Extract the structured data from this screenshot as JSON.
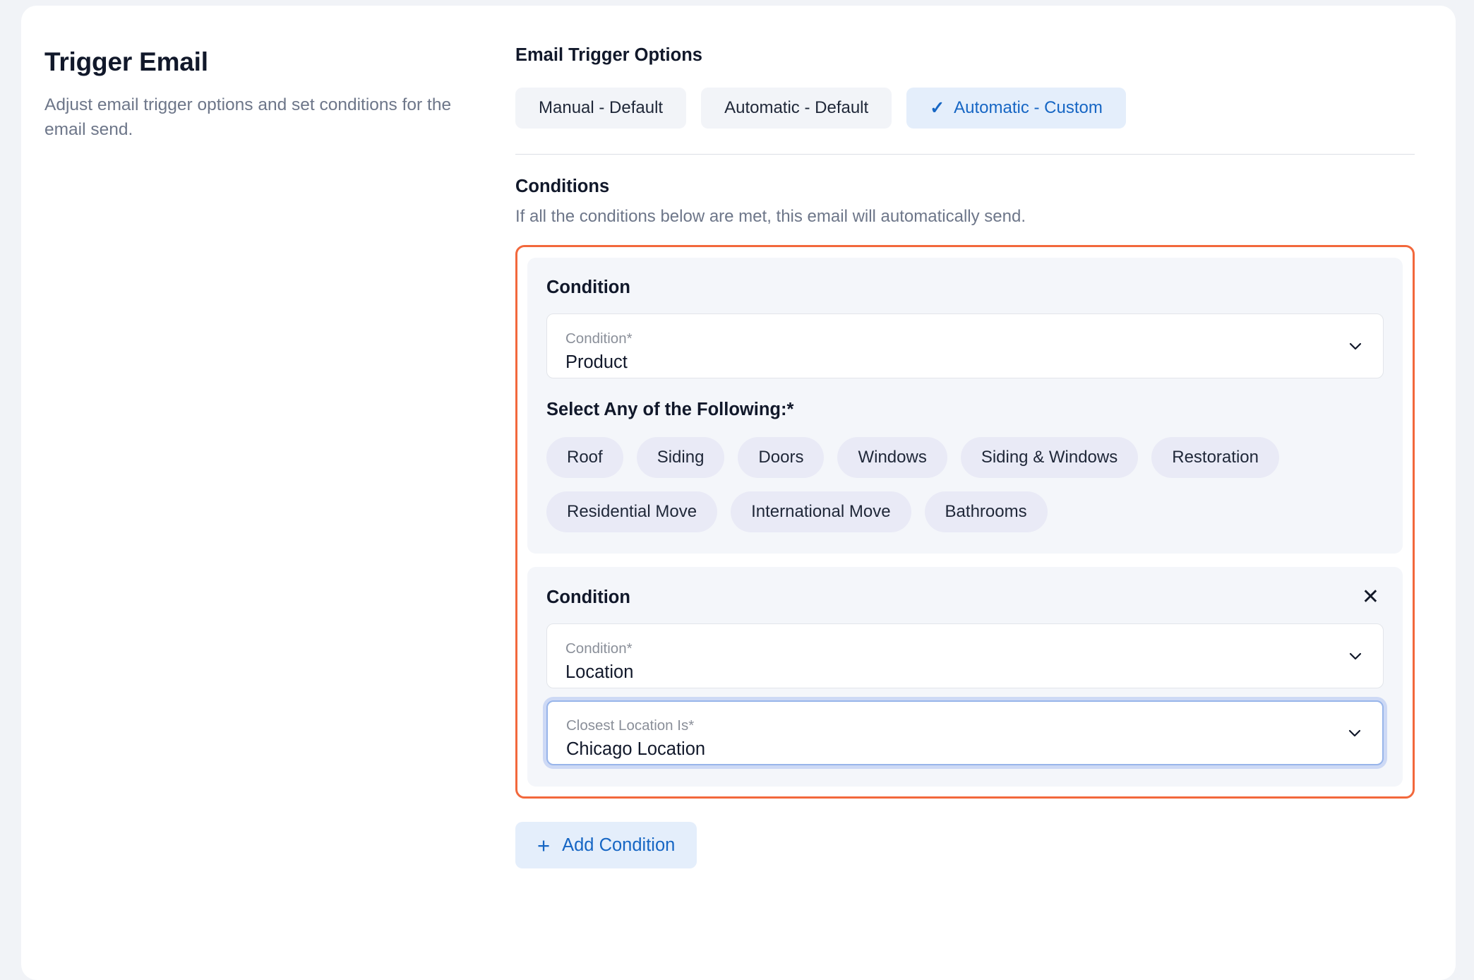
{
  "left": {
    "title": "Trigger Email",
    "subtitle": "Adjust email trigger options and set conditions for the email send."
  },
  "trigger_options": {
    "heading": "Email Trigger Options",
    "tabs": [
      {
        "label": "Manual - Default",
        "selected": false
      },
      {
        "label": "Automatic - Default",
        "selected": false
      },
      {
        "label": "Automatic - Custom",
        "selected": true
      }
    ]
  },
  "conditions_section": {
    "heading": "Conditions",
    "subtitle": "If all the conditions below are met, this email will automatically send.",
    "cards": [
      {
        "title": "Condition",
        "has_close": false,
        "select": {
          "label": "Condition*",
          "value": "Product"
        },
        "chip_group": {
          "label": "Select Any of the Following:*",
          "chips": [
            "Roof",
            "Siding",
            "Doors",
            "Windows",
            "Siding & Windows",
            "Restoration",
            "Residential Move",
            "International Move",
            "Bathrooms"
          ]
        }
      },
      {
        "title": "Condition",
        "has_close": true,
        "close_label": "✕",
        "select": {
          "label": "Condition*",
          "value": "Location"
        },
        "select2": {
          "label": "Closest Location Is*",
          "value": "Chicago Location",
          "focused": true
        }
      }
    ],
    "add_button": {
      "plus": "+",
      "label": "Add Condition"
    }
  },
  "colors": {
    "accent_blue": "#1666c4",
    "highlight_orange": "#f2683c",
    "chip_bg": "#e9eaf6",
    "card_bg": "#f4f6fa",
    "focus_ring": "#cdd9f5"
  }
}
